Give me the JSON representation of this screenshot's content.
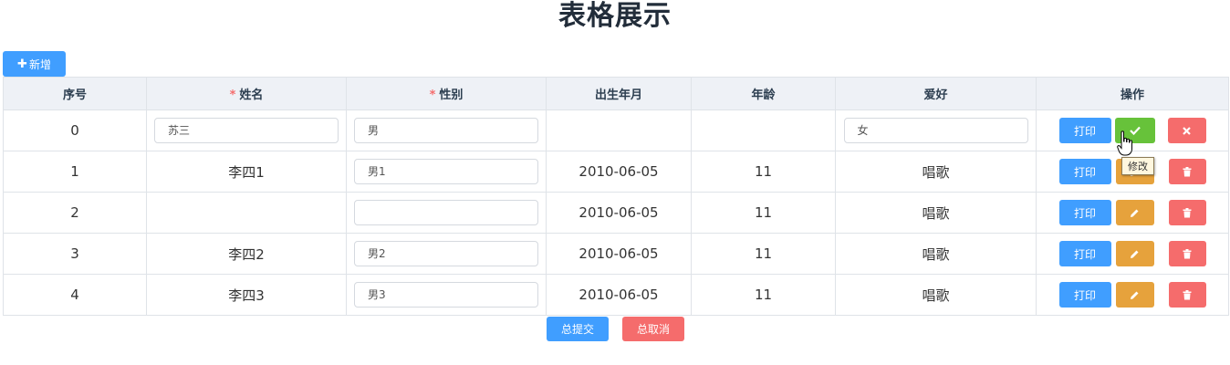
{
  "page": {
    "title": "表格展示"
  },
  "toolbar": {
    "add_label": "新增",
    "add_icon": "plus-icon"
  },
  "table": {
    "columns": {
      "index": "序号",
      "name": "姓名",
      "gender": "性别",
      "birth": "出生年月",
      "age": "年龄",
      "hobby": "爱好",
      "ops": "操作"
    },
    "required_mark": "*",
    "rows": [
      {
        "index": "0",
        "name": "苏三",
        "gender": "男",
        "birth": "",
        "age": "",
        "hobby": "女",
        "editing": true
      },
      {
        "index": "1",
        "name": "李四1",
        "gender": "男1",
        "birth": "2010-06-05",
        "age": "11",
        "hobby": "唱歌",
        "editing": false
      },
      {
        "index": "2",
        "name": "",
        "gender": "",
        "birth": "2010-06-05",
        "age": "11",
        "hobby": "唱歌",
        "editing": false
      },
      {
        "index": "3",
        "name": "李四2",
        "gender": "男2",
        "birth": "2010-06-05",
        "age": "11",
        "hobby": "唱歌",
        "editing": false
      },
      {
        "index": "4",
        "name": "李四3",
        "gender": "男3",
        "birth": "2010-06-05",
        "age": "11",
        "hobby": "唱歌",
        "editing": false
      }
    ],
    "actions": {
      "print_label": "打印",
      "confirm_icon": "check-icon",
      "cancel_icon": "close-icon",
      "edit_icon": "pencil-icon",
      "delete_icon": "trash-icon"
    }
  },
  "tooltip": {
    "text": "修改"
  },
  "footer": {
    "submit_label": "总提交",
    "cancel_label": "总取消"
  },
  "colors": {
    "primary": "#409eff",
    "success": "#67c23a",
    "warning": "#e6a23c",
    "danger": "#f56c6c",
    "header_bg": "#eef1f6"
  }
}
